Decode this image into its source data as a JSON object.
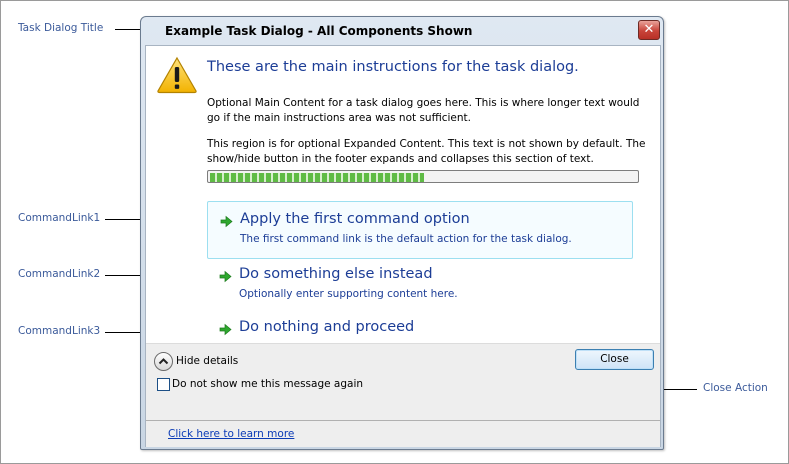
{
  "callouts": {
    "task_dialog_title": "Task Dialog Title",
    "commandlink1": "CommandLink1",
    "commandlink2": "CommandLink2",
    "commandlink3": "CommandLink3",
    "close_action": "Close Action"
  },
  "dialog": {
    "title": "Example Task Dialog - All Components Shown",
    "close_glyph": "✕",
    "main_instruction": "These are the main instructions for the task dialog.",
    "content": "Optional Main Content for a task dialog goes here. This is where longer text would go if the main instructions area was not sufficient.",
    "expanded_content": "This region is for optional Expanded Content. This text is not shown by default. The show/hide button in the footer expands and collapses this section of text.",
    "progress_fraction": 0.5,
    "icon": "warning-icon",
    "command_links": [
      {
        "main": "Apply the first command option",
        "note": "The first command link is the default action for the task dialog."
      },
      {
        "main": "Do something else instead",
        "note": "Optionally enter supporting content here."
      },
      {
        "main": "Do nothing and proceed",
        "note": ""
      }
    ],
    "footer": {
      "toggle_label": "Hide details",
      "checkbox_label": "Do not show me this message again",
      "checkbox_checked": false,
      "close_button": "Close",
      "learn_link": "Click here to learn more"
    },
    "colors": {
      "instruction_blue": "#1c3d96",
      "arrow_green": "#2fa82f",
      "close_red": "#c8443a"
    }
  }
}
